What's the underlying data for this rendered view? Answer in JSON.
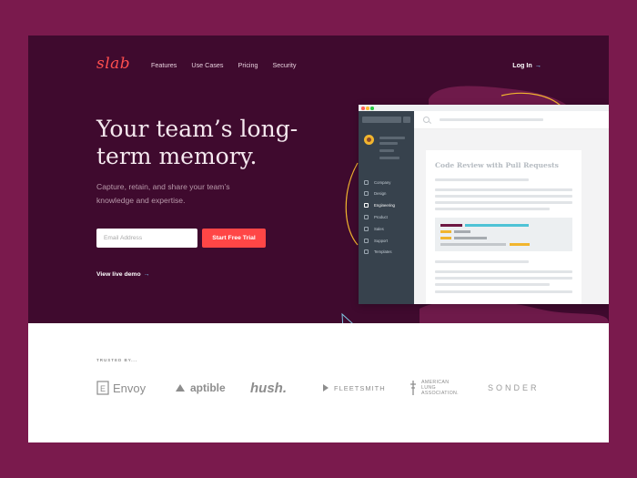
{
  "brand": {
    "logo": "slab",
    "accent": "#ff4646",
    "hero_bg": "#3f0a2e",
    "outer_bg": "#7a1a4d"
  },
  "nav": {
    "items": [
      "Features",
      "Use Cases",
      "Pricing",
      "Security"
    ],
    "login": "Log In",
    "login_arrow": "→"
  },
  "hero": {
    "headline": "Your team’s long-term memory.",
    "subtext": "Capture, retain, and share your team’s knowledge and expertise.",
    "email_placeholder": "Email Address",
    "cta": "Start Free Trial",
    "demo_link": "View live demo",
    "demo_arrow": "→"
  },
  "app": {
    "sidebar": [
      "Company",
      "Design",
      "Engineering",
      "Product",
      "Sales",
      "Support",
      "Templates"
    ],
    "sidebar_icons": [
      "building-icon",
      "pen-icon",
      "terminal-icon",
      "phone-icon",
      "chart-icon",
      "headset-icon",
      "template-icon"
    ],
    "active_item": "Engineering",
    "doc_title": "Code Review with Pull Requests"
  },
  "trusted": {
    "label": "TRUSTED BY...",
    "logos": [
      {
        "name": "Envoy",
        "icon": "envoy-icon"
      },
      {
        "name": "aptible",
        "icon": "aptible-icon"
      },
      {
        "name": "hush.",
        "icon": ""
      },
      {
        "name": "FLEETSMITH",
        "icon": "fleetsmith-icon"
      },
      {
        "name": "AMERICAN LUNG ASSOCIATION.",
        "lines": [
          "AMERICAN",
          "LUNG",
          "ASSOCIATION."
        ],
        "icon": "cross-icon"
      },
      {
        "name": "SONDER",
        "icon": ""
      }
    ]
  }
}
